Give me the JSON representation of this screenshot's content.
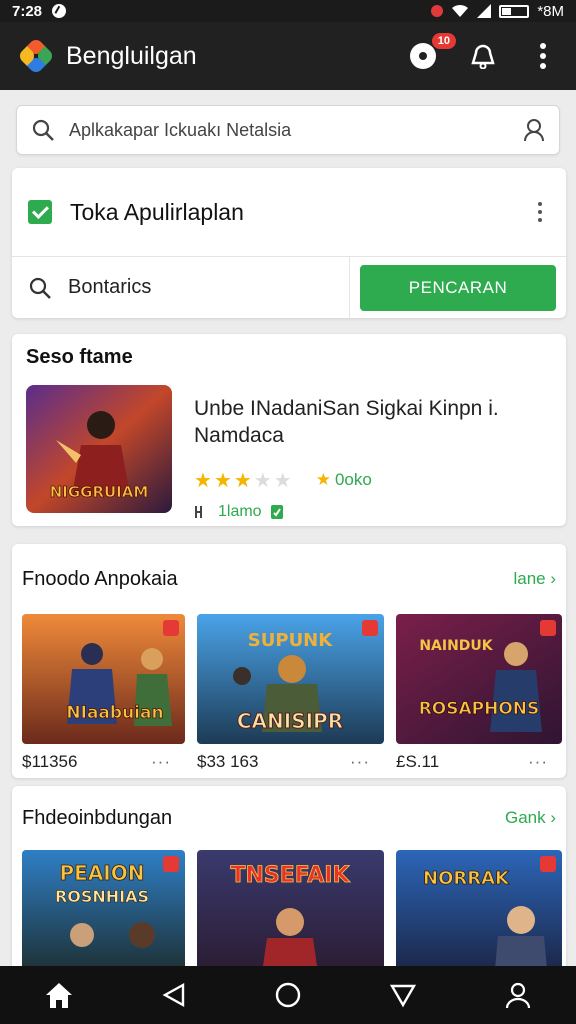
{
  "status_bar": {
    "time": "7:28",
    "right_text": "*8M"
  },
  "app_bar": {
    "title": "Bengluilgan",
    "notification_count": "10"
  },
  "search": {
    "placeholder": "Aplkakapar Ickuakı Netalsia"
  },
  "store_card": {
    "title": "Toka Apulirlaplan",
    "field_text": "Bontarics",
    "button_label": "PENCARAN"
  },
  "featured": {
    "section_title": "Seso ftame",
    "app_name": "Unbe INadaniSan Sigkai Kinpn i. Namdaca",
    "rating": 2.5,
    "rating_label": "0oko",
    "meta": "1lamo",
    "cover_caption": "NIGGRUIAM"
  },
  "row1": {
    "title": "Fnoodo Anpokaia",
    "more_label": "lane",
    "tiles": [
      {
        "caption": "NIaabuian",
        "price": "$11356"
      },
      {
        "caption": "CANISIPR",
        "price": "$33 163"
      },
      {
        "caption": "ROSAPHONS",
        "price": "£S.11"
      }
    ]
  },
  "row2": {
    "title": "Fhdeoinbdungan",
    "more_label": "Gank",
    "tiles": [
      {
        "caption": "ROSNHIAS"
      },
      {
        "caption": "TNSEFAIK"
      },
      {
        "caption": "NORRAK"
      }
    ]
  },
  "colors": {
    "accent": "#2eaa4f",
    "appbar": "#212121",
    "badge": "#e53935"
  }
}
